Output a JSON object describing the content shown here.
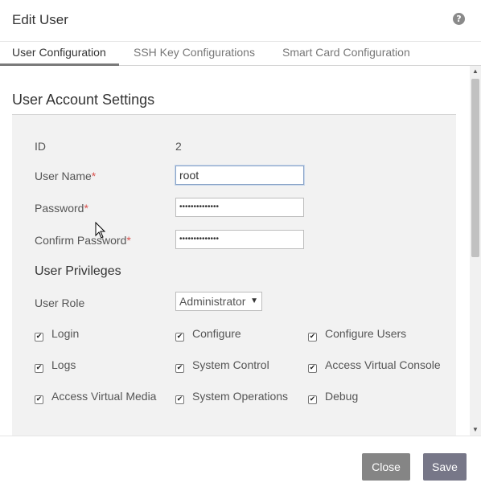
{
  "dialog": {
    "title": "Edit User",
    "help_icon": "?"
  },
  "tabs": [
    {
      "label": "User Configuration",
      "active": true
    },
    {
      "label": "SSH Key Configurations",
      "active": false
    },
    {
      "label": "Smart Card Configuration",
      "active": false
    }
  ],
  "account": {
    "section_title": "User Account Settings",
    "id_label": "ID",
    "id_value": "2",
    "username_label": "User Name",
    "username_value": "root",
    "password_label": "Password",
    "password_value": "••••••••••••••",
    "confirm_label": "Confirm Password",
    "confirm_value": "••••••••••••••",
    "required_marker": "*"
  },
  "privileges": {
    "title": "User Privileges",
    "role_label": "User Role",
    "role_value": "Administrator",
    "role_caret": "▼",
    "items": [
      {
        "label": "Login",
        "checked": true
      },
      {
        "label": "Configure",
        "checked": true
      },
      {
        "label": "Configure Users",
        "checked": true
      },
      {
        "label": "Logs",
        "checked": true
      },
      {
        "label": "System Control",
        "checked": true
      },
      {
        "label": "Access Virtual Console",
        "checked": true
      },
      {
        "label": "Access Virtual Media",
        "checked": true
      },
      {
        "label": "System Operations",
        "checked": true
      },
      {
        "label": "Debug",
        "checked": true
      }
    ],
    "check_glyph": "✔"
  },
  "footer": {
    "close_label": "Close",
    "save_label": "Save"
  },
  "scrollbar": {
    "up": "▲",
    "down": "▼"
  }
}
